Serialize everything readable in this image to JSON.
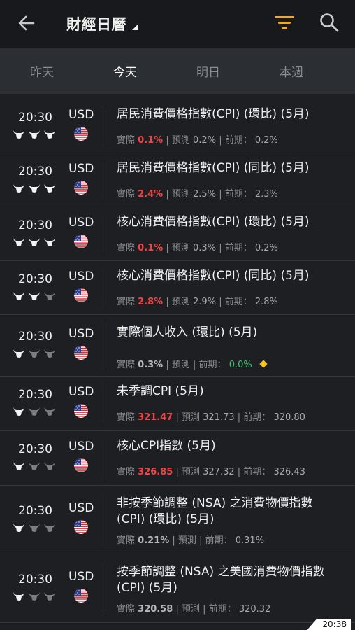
{
  "header": {
    "back_icon": "arrow-left-icon",
    "title": "財經日曆",
    "filter_icon": "filter-icon",
    "search_icon": "search-icon",
    "accent_color": "#f5a623"
  },
  "tabs": [
    {
      "label": "昨天",
      "active": false
    },
    {
      "label": "今天",
      "active": true
    },
    {
      "label": "明日",
      "active": false
    },
    {
      "label": "本週",
      "active": false
    }
  ],
  "events": [
    {
      "time": "20:30",
      "currency": "USD",
      "importance": 3,
      "title": "居民消費價格指數(CPI) (環比) (5月)",
      "actual_label": "實際",
      "actual": "0.1%",
      "forecast_label": "預測",
      "forecast": "0.2%",
      "previous_label": "前期：",
      "previous": "0.2%"
    },
    {
      "time": "20:30",
      "currency": "USD",
      "importance": 3,
      "title": "居民消費價格指數(CPI) (同比) (5月)",
      "actual_label": "實際",
      "actual": "2.4%",
      "forecast_label": "預測",
      "forecast": "2.5%",
      "previous_label": "前期：",
      "previous": "2.3%"
    },
    {
      "time": "20:30",
      "currency": "USD",
      "importance": 3,
      "title": "核心消費價格指數(CPI) (環比) (5月)",
      "actual_label": "實際",
      "actual": "0.1%",
      "forecast_label": "預測",
      "forecast": "0.3%",
      "previous_label": "前期：",
      "previous": "0.2%"
    },
    {
      "time": "20:30",
      "currency": "USD",
      "importance": 2,
      "title": "核心消費價格指數(CPI) (同比) (5月)",
      "actual_label": "實際",
      "actual": "2.8%",
      "forecast_label": "預測",
      "forecast": "2.9%",
      "previous_label": "前期：",
      "previous": "2.8%"
    },
    {
      "time": "20:30",
      "currency": "USD",
      "importance": 1,
      "title": "實際個人收入 (環比) (5月)",
      "actual_label": "實際",
      "actual": "0.3%",
      "forecast_label": "預測",
      "forecast": "",
      "previous_label": "前期：",
      "previous": "0.0%"
    },
    {
      "time": "20:30",
      "currency": "USD",
      "importance": 1,
      "title": "未季調CPI (5月)",
      "actual_label": "實際",
      "actual": "321.47",
      "forecast_label": "預測",
      "forecast": "321.73",
      "previous_label": "前期：",
      "previous": "320.80"
    },
    {
      "time": "20:30",
      "currency": "USD",
      "importance": 1,
      "title": "核心CPI指數 (5月)",
      "actual_label": "實際",
      "actual": "326.85",
      "forecast_label": "預測",
      "forecast": "327.32",
      "previous_label": "前期：",
      "previous": "326.43"
    },
    {
      "time": "20:30",
      "currency": "USD",
      "importance": 1,
      "title": "非按季節調整 (NSA) 之消費物價指數 (CPI) (環比) (5月)",
      "actual_label": "實際",
      "actual": "0.21%",
      "forecast_label": "預測",
      "forecast": "",
      "previous_label": "前期：",
      "previous": "0.31%"
    },
    {
      "time": "20:30",
      "currency": "USD",
      "importance": 1,
      "title": "按季節調整 (NSA) 之美國消費物價指數 (CPI) (5月)",
      "actual_label": "實際",
      "actual": "320.58",
      "forecast_label": "預測",
      "forecast": "",
      "previous_label": "前期：",
      "previous": "320.32"
    }
  ],
  "status_bar": {
    "time": "20:38"
  }
}
